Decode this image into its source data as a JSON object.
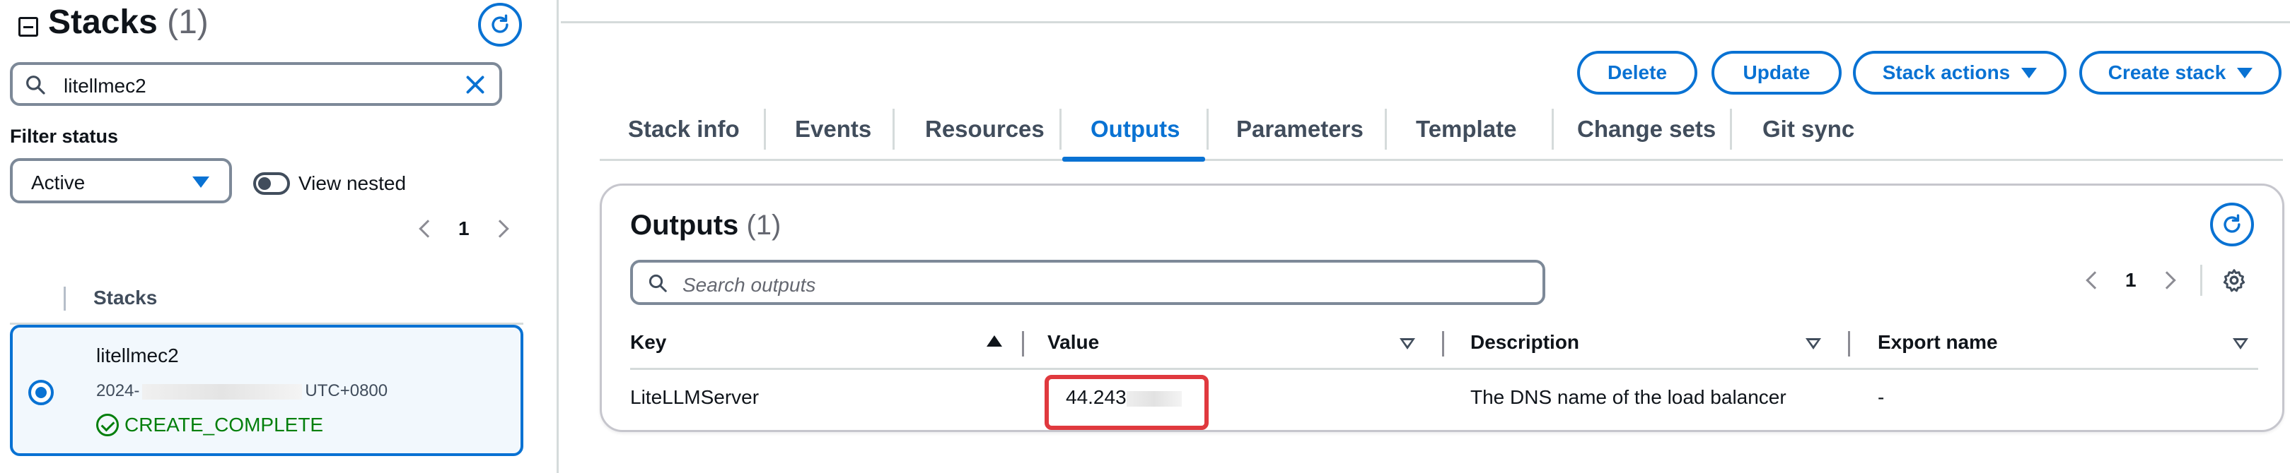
{
  "sidebar": {
    "title": "Stacks",
    "count": "(1)",
    "search_value": "litellmec2",
    "filter_label": "Filter status",
    "filter_value": "Active",
    "view_nested_label": "View nested",
    "page": "1",
    "column_header": "Stacks",
    "stack": {
      "name": "litellmec2",
      "date_prefix": "2024-",
      "date_suffix": "UTC+0800",
      "status": "CREATE_COMPLETE"
    }
  },
  "toolbar": {
    "delete_label": "Delete",
    "update_label": "Update",
    "stack_actions_label": "Stack actions",
    "create_stack_label": "Create stack"
  },
  "tabs": [
    {
      "label": "Stack info"
    },
    {
      "label": "Events"
    },
    {
      "label": "Resources"
    },
    {
      "label": "Outputs",
      "active": true
    },
    {
      "label": "Parameters"
    },
    {
      "label": "Template"
    },
    {
      "label": "Change sets"
    },
    {
      "label": "Git sync"
    }
  ],
  "outputs": {
    "title": "Outputs",
    "count": "(1)",
    "search_placeholder": "Search outputs",
    "page": "1",
    "columns": [
      "Key",
      "Value",
      "Description",
      "Export name"
    ],
    "rows": [
      {
        "key": "LiteLLMServer",
        "value": "44.243",
        "description": "The DNS name of the load balancer",
        "export_name": "-"
      }
    ]
  },
  "colors": {
    "accent": "#0972d3",
    "success": "#037f0c",
    "highlight": "#e0393e"
  },
  "icons": [
    "collapse-icon",
    "refresh-icon",
    "search-icon",
    "close-icon",
    "caret-down-icon",
    "chevron-left-icon",
    "chevron-right-icon",
    "check-circle-icon",
    "settings-icon",
    "sort-ascending-icon",
    "sort-icon"
  ]
}
